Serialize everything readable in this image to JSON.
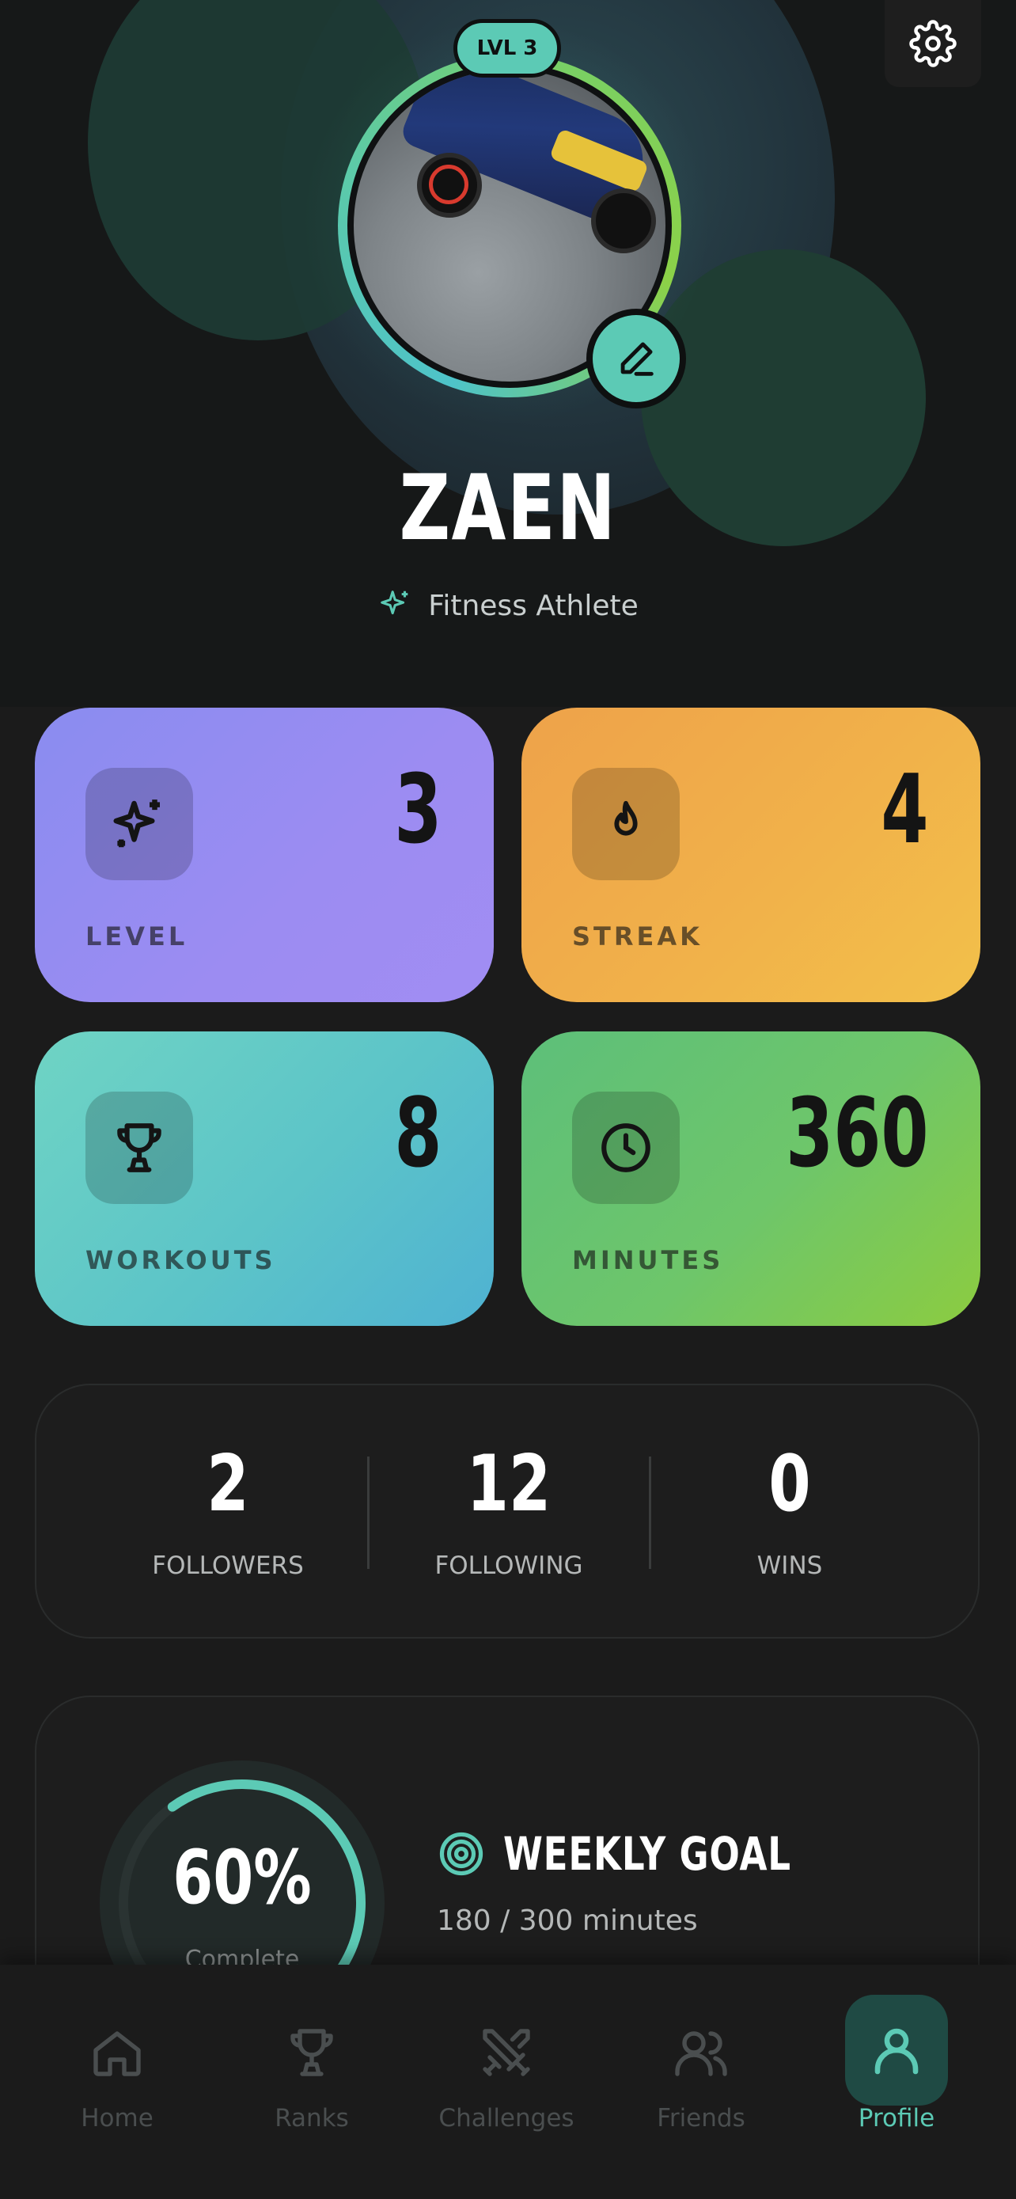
{
  "header": {
    "level_badge": "LVL 3",
    "name": "ZAEN",
    "role": "Fitness Athlete"
  },
  "icons": {
    "settings": "gear-icon",
    "edit": "pencil-icon",
    "role": "sparkles-icon"
  },
  "stats": [
    {
      "key": "level",
      "label": "LEVEL",
      "value": "3",
      "icon": "sparkles-icon",
      "color": "#9a8cf2"
    },
    {
      "key": "streak",
      "label": "STREAK",
      "value": "4",
      "icon": "flame-icon",
      "color": "#f1b14a"
    },
    {
      "key": "workouts",
      "label": "WORKOUTS",
      "value": "8",
      "icon": "trophy-icon",
      "color": "#5cc4c8"
    },
    {
      "key": "minutes",
      "label": "MINUTES",
      "value": "360",
      "icon": "clock-icon",
      "color": "#6ec66a"
    }
  ],
  "social": [
    {
      "label": "FOLLOWERS",
      "value": "2"
    },
    {
      "label": "FOLLOWING",
      "value": "12"
    },
    {
      "label": "WINS",
      "value": "0"
    }
  ],
  "weekly_goal": {
    "title": "WEEKLY GOAL",
    "subtitle": "180 / 300 minutes",
    "percent_text": "60%",
    "progress": 0.6,
    "complete_label": "Complete",
    "accent": "#5ccab5"
  },
  "tabs": [
    {
      "label": "Home",
      "icon": "home-icon",
      "active": false
    },
    {
      "label": "Ranks",
      "icon": "trophy-icon",
      "active": false
    },
    {
      "label": "Challenges",
      "icon": "swords-icon",
      "active": false
    },
    {
      "label": "Friends",
      "icon": "users-icon",
      "active": false
    },
    {
      "label": "Profile",
      "icon": "user-icon",
      "active": true
    }
  ]
}
